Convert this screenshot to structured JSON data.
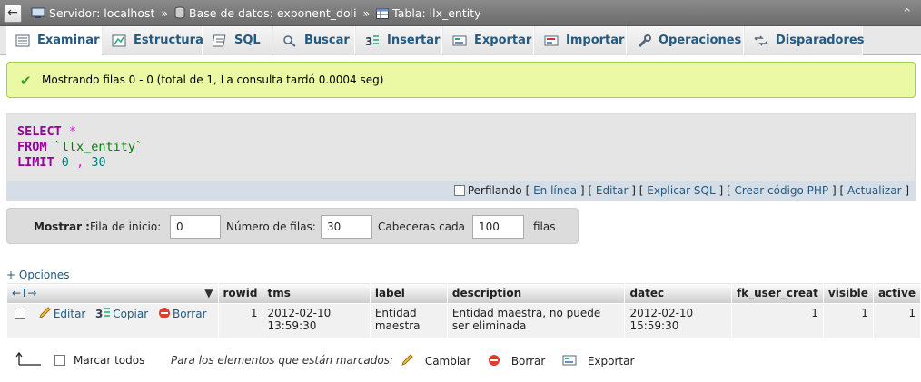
{
  "breadcrumb": {
    "server": "Servidor: localhost",
    "database": "Base de datos: exponent_doli",
    "table": "Tabla: llx_entity",
    "separator": "»"
  },
  "tabs": [
    {
      "label": "Examinar",
      "icon": "browse-icon",
      "active": true
    },
    {
      "label": "Estructura",
      "icon": "structure-icon"
    },
    {
      "label": "SQL",
      "icon": "sql-icon"
    },
    {
      "label": "Buscar",
      "icon": "search-icon"
    },
    {
      "label": "Insertar",
      "icon": "insert-icon"
    },
    {
      "label": "Exportar",
      "icon": "export-icon"
    },
    {
      "label": "Importar",
      "icon": "import-icon"
    },
    {
      "label": "Operaciones",
      "icon": "wrench-icon"
    },
    {
      "label": "Disparadores",
      "icon": "triggers-icon"
    }
  ],
  "success_message": "Mostrando filas 0 - 0 (total de 1, La consulta tardó 0.0004 seg)",
  "sql": {
    "select": "SELECT",
    "star": "*",
    "from": "FROM",
    "table": "`llx_entity`",
    "limit": "LIMIT",
    "offset": "0",
    "comma": ",",
    "count": "30"
  },
  "sql_links": {
    "profiling": "Perfilando",
    "inline": "En línea",
    "edit": "Editar",
    "explain": "Explicar SQL",
    "php": "Crear código PHP",
    "refresh": "Actualizar"
  },
  "nav": {
    "show_label": "Mostrar :",
    "start_label": "Fila de inicio:",
    "start_value": "0",
    "rows_label": "Número de filas:",
    "rows_value": "30",
    "headers_label": "Cabeceras cada",
    "headers_value": "100",
    "rows_suffix": "filas"
  },
  "options_link": "+ Opciones",
  "table": {
    "arrows": "←T→",
    "columns": [
      "rowid",
      "tms",
      "label",
      "description",
      "datec",
      "fk_user_creat",
      "visible",
      "active"
    ],
    "rows": [
      {
        "edit": "Editar",
        "copy": "Copiar",
        "delete": "Borrar",
        "rowid": "1",
        "tms": "2012-02-10 13:59:30",
        "label": "Entidad maestra",
        "description": "Entidad maestra, no puede ser eliminada",
        "datec": "2012-02-10 15:59:30",
        "fk_user_creat": "1",
        "visible": "1",
        "active": "1"
      }
    ]
  },
  "bulk": {
    "check_all": "Marcar todos",
    "with_selected": "Para los elementos que están marcados:",
    "change": "Cambiar",
    "delete": "Borrar",
    "export": "Exportar"
  },
  "colors": {
    "link": "#235a81",
    "success_bg": "#ebf8a4",
    "keyword": "#990099"
  }
}
